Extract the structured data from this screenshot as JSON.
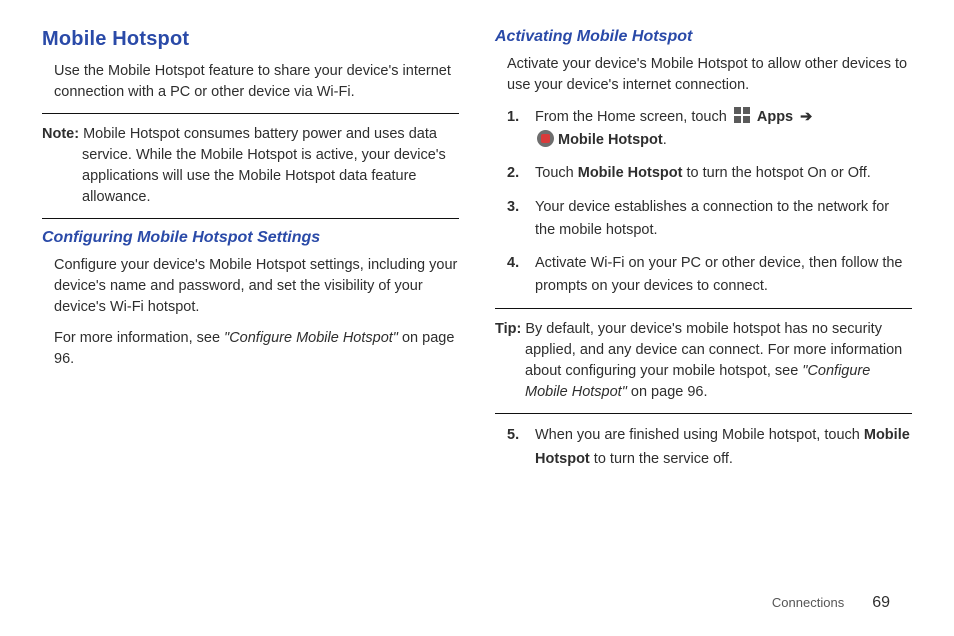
{
  "left": {
    "title": "Mobile Hotspot",
    "intro": "Use the Mobile Hotspot feature to share your device's internet connection with a PC or other device via Wi-Fi.",
    "note_label": "Note:",
    "note_body": "Mobile Hotspot consumes battery power and uses data service. While the Mobile Hotspot is active, your device's applications will use the Mobile Hotspot data feature allowance.",
    "sub1": "Configuring Mobile Hotspot Settings",
    "sub1_p1": "Configure your device's Mobile Hotspot settings, including your device's name and password, and set the visibility of your device's Wi-Fi hotspot.",
    "sub1_p2_a": "For more information, see ",
    "sub1_p2_ref": "\"Configure Mobile Hotspot\"",
    "sub1_p2_b": " on page 96."
  },
  "right": {
    "sub2": "Activating Mobile Hotspot",
    "intro2": "Activate your device's Mobile Hotspot to allow other devices to use your device's internet connection.",
    "steps": {
      "s1_num": "1.",
      "s1_a": "From the Home screen, touch ",
      "s1_apps": "Apps",
      "s1_arrow": "➔",
      "s1_hotspot": "Mobile Hotspot",
      "s1_period": ".",
      "s2_num": "2.",
      "s2_a": "Touch ",
      "s2_bold": "Mobile Hotspot",
      "s2_b": " to turn the hotspot On or Off.",
      "s3_num": "3.",
      "s3": "Your device establishes a connection to the network for the mobile hotspot.",
      "s4_num": "4.",
      "s4": "Activate Wi-Fi on your PC or other device, then follow the prompts on your devices to connect.",
      "s5_num": "5.",
      "s5_a": "When you are finished using Mobile hotspot, touch ",
      "s5_bold": "Mobile Hotspot",
      "s5_b": " to turn the service off."
    },
    "tip_label": "Tip:",
    "tip_a": "By default, your device's mobile hotspot has no security applied, and any device can connect. For more information about configuring your mobile hotspot, see ",
    "tip_ref": "\"Configure Mobile Hotspot\"",
    "tip_b": " on page 96."
  },
  "footer": {
    "section": "Connections",
    "page": "69"
  }
}
